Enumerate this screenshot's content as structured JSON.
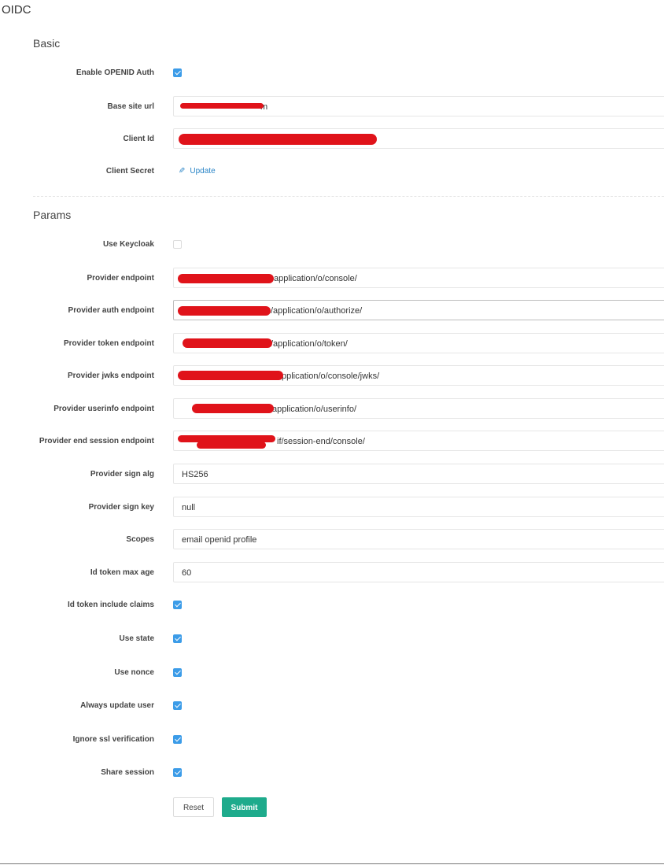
{
  "page": {
    "title": "OIDC"
  },
  "sections": {
    "basic": "Basic",
    "params": "Params"
  },
  "basic": {
    "enable_openid_auth": {
      "label": "Enable OPENID Auth",
      "checked": true
    },
    "base_site_url": {
      "label": "Base site url",
      "value": "m"
    },
    "client_id": {
      "label": "Client Id",
      "value": ""
    },
    "client_secret": {
      "label": "Client Secret",
      "link": "Update",
      "icon": "pencil-icon"
    }
  },
  "params": {
    "use_keycloak": {
      "label": "Use Keycloak",
      "checked": false
    },
    "provider_endpoint": {
      "label": "Provider endpoint",
      "value": "application/o/console/"
    },
    "provider_auth_endpoint": {
      "label": "Provider auth endpoint",
      "value": "/application/o/authorize/"
    },
    "provider_token_endpoint": {
      "label": "Provider token endpoint",
      "value": "/application/o/token/"
    },
    "provider_jwks_endpoint": {
      "label": "Provider jwks endpoint",
      "value": "pplication/o/console/jwks/"
    },
    "provider_userinfo_endpoint": {
      "label": "Provider userinfo endpoint",
      "value": "application/o/userinfo/"
    },
    "provider_end_session_endpoint": {
      "label": "Provider end session endpoint",
      "value": "if/session-end/console/"
    },
    "provider_sign_alg": {
      "label": "Provider sign alg",
      "value": "HS256"
    },
    "provider_sign_key": {
      "label": "Provider sign key",
      "value": "null"
    },
    "scopes": {
      "label": "Scopes",
      "value": "email openid profile"
    },
    "id_token_max_age": {
      "label": "Id token max age",
      "value": "60"
    },
    "id_token_include_claims": {
      "label": "Id token include claims",
      "checked": true
    },
    "use_state": {
      "label": "Use state",
      "checked": true
    },
    "use_nonce": {
      "label": "Use nonce",
      "checked": true
    },
    "always_update_user": {
      "label": "Always update user",
      "checked": true
    },
    "ignore_ssl_verification": {
      "label": "Ignore ssl verification",
      "checked": true
    },
    "share_session": {
      "label": "Share session",
      "checked": true
    }
  },
  "actions": {
    "reset": "Reset",
    "submit": "Submit"
  },
  "colors": {
    "checkbox_checked": "#3c9ce8",
    "link": "#2a85c7",
    "submit_button": "#1eab8c",
    "redaction": "#e0131a"
  }
}
